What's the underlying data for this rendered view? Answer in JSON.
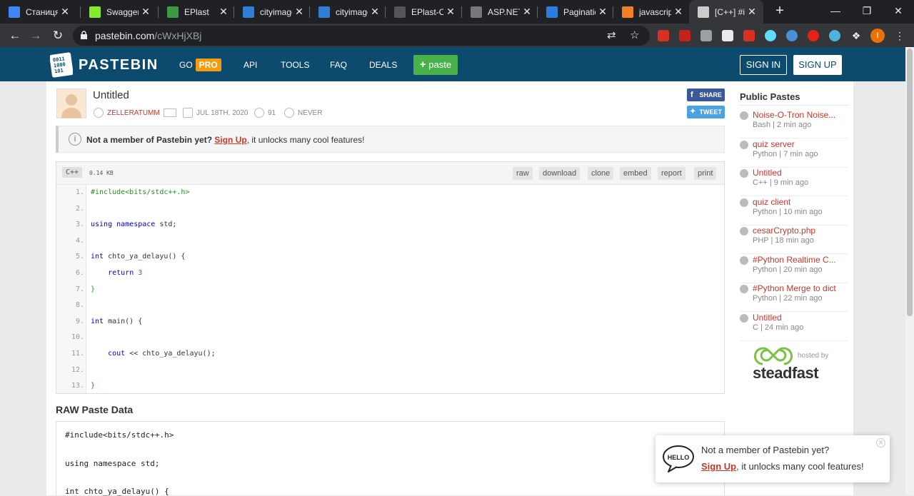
{
  "browser": {
    "tabs": [
      {
        "title": "Станиця",
        "icon": "doc-icon",
        "color": "#4285f4"
      },
      {
        "title": "Swagger",
        "icon": "swagger-icon",
        "color": "#85ea2d"
      },
      {
        "title": "EPlast",
        "icon": "eplast-icon",
        "color": "#3c9a44"
      },
      {
        "title": "cityimage",
        "icon": "azure-icon",
        "color": "#2f7fd6"
      },
      {
        "title": "cityimage",
        "icon": "azure-icon",
        "color": "#2f7fd6"
      },
      {
        "title": "EPlast-Cl",
        "icon": "github-icon",
        "color": "#555555"
      },
      {
        "title": "ASP.NET",
        "icon": "mail-icon",
        "color": "#777777"
      },
      {
        "title": "Paginatio",
        "icon": "diamond-icon",
        "color": "#2a7de1"
      },
      {
        "title": "javascript",
        "icon": "stackoverflow-icon",
        "color": "#f48024"
      },
      {
        "title": "[C++] #i",
        "icon": "pastebin-icon",
        "color": "#cccccc"
      }
    ],
    "url_host": "pastebin.com",
    "url_path": "/cWxHjXBj",
    "profile_initial": "I"
  },
  "header": {
    "logo": "PASTEBIN",
    "logo_digits": "0011 1000 101",
    "nav": {
      "go": "GO",
      "pro": "PRO",
      "api": "API",
      "tools": "TOOLS",
      "faq": "FAQ",
      "deals": "DEALS"
    },
    "paste_btn": "paste",
    "sign_in": "SIGN IN",
    "sign_up": "SIGN UP"
  },
  "paste": {
    "title": "Untitled",
    "author": "ZELLERATUMM",
    "date": "JUL 18TH, 2020",
    "views": "91",
    "expire": "NEVER",
    "share": "SHARE",
    "tweet": "TWEET"
  },
  "notice": {
    "prefix": "Not a member of Pastebin yet?",
    "link": "Sign Up",
    "suffix": ", it unlocks many cool features!"
  },
  "code": {
    "lang": "C++",
    "size": "0.14 KB",
    "actions": [
      "raw",
      "download",
      "clone",
      "embed",
      "report",
      "print"
    ],
    "lines": [
      {
        "n": "1.",
        "parts": [
          {
            "t": "#include<bits/stdc++.h>",
            "k": "pp"
          }
        ]
      },
      {
        "n": "2.",
        "parts": []
      },
      {
        "n": "3.",
        "parts": [
          {
            "t": "using",
            "k": "kw"
          },
          {
            "t": " ",
            "k": ""
          },
          {
            "t": "namespace",
            "k": "kw"
          },
          {
            "t": " std;",
            "k": ""
          }
        ]
      },
      {
        "n": "4.",
        "parts": []
      },
      {
        "n": "5.",
        "parts": [
          {
            "t": "int",
            "k": "kw"
          },
          {
            "t": " chto_ya_delayu() {",
            "k": ""
          }
        ]
      },
      {
        "n": "6.",
        "parts": [
          {
            "t": "    ",
            "k": ""
          },
          {
            "t": "return",
            "k": "kw"
          },
          {
            "t": " ",
            "k": ""
          },
          {
            "t": "3",
            "k": "pp"
          }
        ]
      },
      {
        "n": "7.",
        "parts": [
          {
            "t": "}",
            "k": "pp"
          }
        ]
      },
      {
        "n": "8.",
        "parts": []
      },
      {
        "n": "9.",
        "parts": [
          {
            "t": "int",
            "k": "kw"
          },
          {
            "t": " main() {",
            "k": ""
          }
        ]
      },
      {
        "n": "10.",
        "parts": []
      },
      {
        "n": "11.",
        "parts": [
          {
            "t": "    ",
            "k": ""
          },
          {
            "t": "cout",
            "k": "kw"
          },
          {
            "t": " << chto_ya_delayu();",
            "k": ""
          }
        ]
      },
      {
        "n": "12.",
        "parts": []
      },
      {
        "n": "13.",
        "parts": [
          {
            "t": "}",
            "k": "pp"
          }
        ]
      }
    ]
  },
  "raw": {
    "heading": "RAW Paste Data",
    "lines": [
      "#include<bits/stdc++.h>",
      "",
      "using namespace std;",
      "",
      "int chto_ya_delayu() {"
    ]
  },
  "sidebar": {
    "heading": "Public Pastes",
    "items": [
      {
        "title": "Noise-O-Tron Noise...",
        "meta": "Bash | 2 min ago"
      },
      {
        "title": "quiz server",
        "meta": "Python | 7 min ago"
      },
      {
        "title": "Untitled",
        "meta": "C++ | 9 min ago"
      },
      {
        "title": "quiz client",
        "meta": "Python | 10 min ago"
      },
      {
        "title": "cesarCrypto.php",
        "meta": "PHP | 18 min ago"
      },
      {
        "title": "#Python Realtime C...",
        "meta": "Python | 20 min ago"
      },
      {
        "title": "#Python Merge to dict",
        "meta": "Python | 22 min ago"
      },
      {
        "title": "Untitled",
        "meta": "C | 24 min ago"
      }
    ],
    "hosted_by": "hosted by",
    "sponsor": "steadfast"
  },
  "toast": {
    "hello": "HELLO",
    "line1": "Not a member of Pastebin yet?",
    "link": "Sign Up",
    "line2_suffix": ", it unlocks many cool features!"
  }
}
